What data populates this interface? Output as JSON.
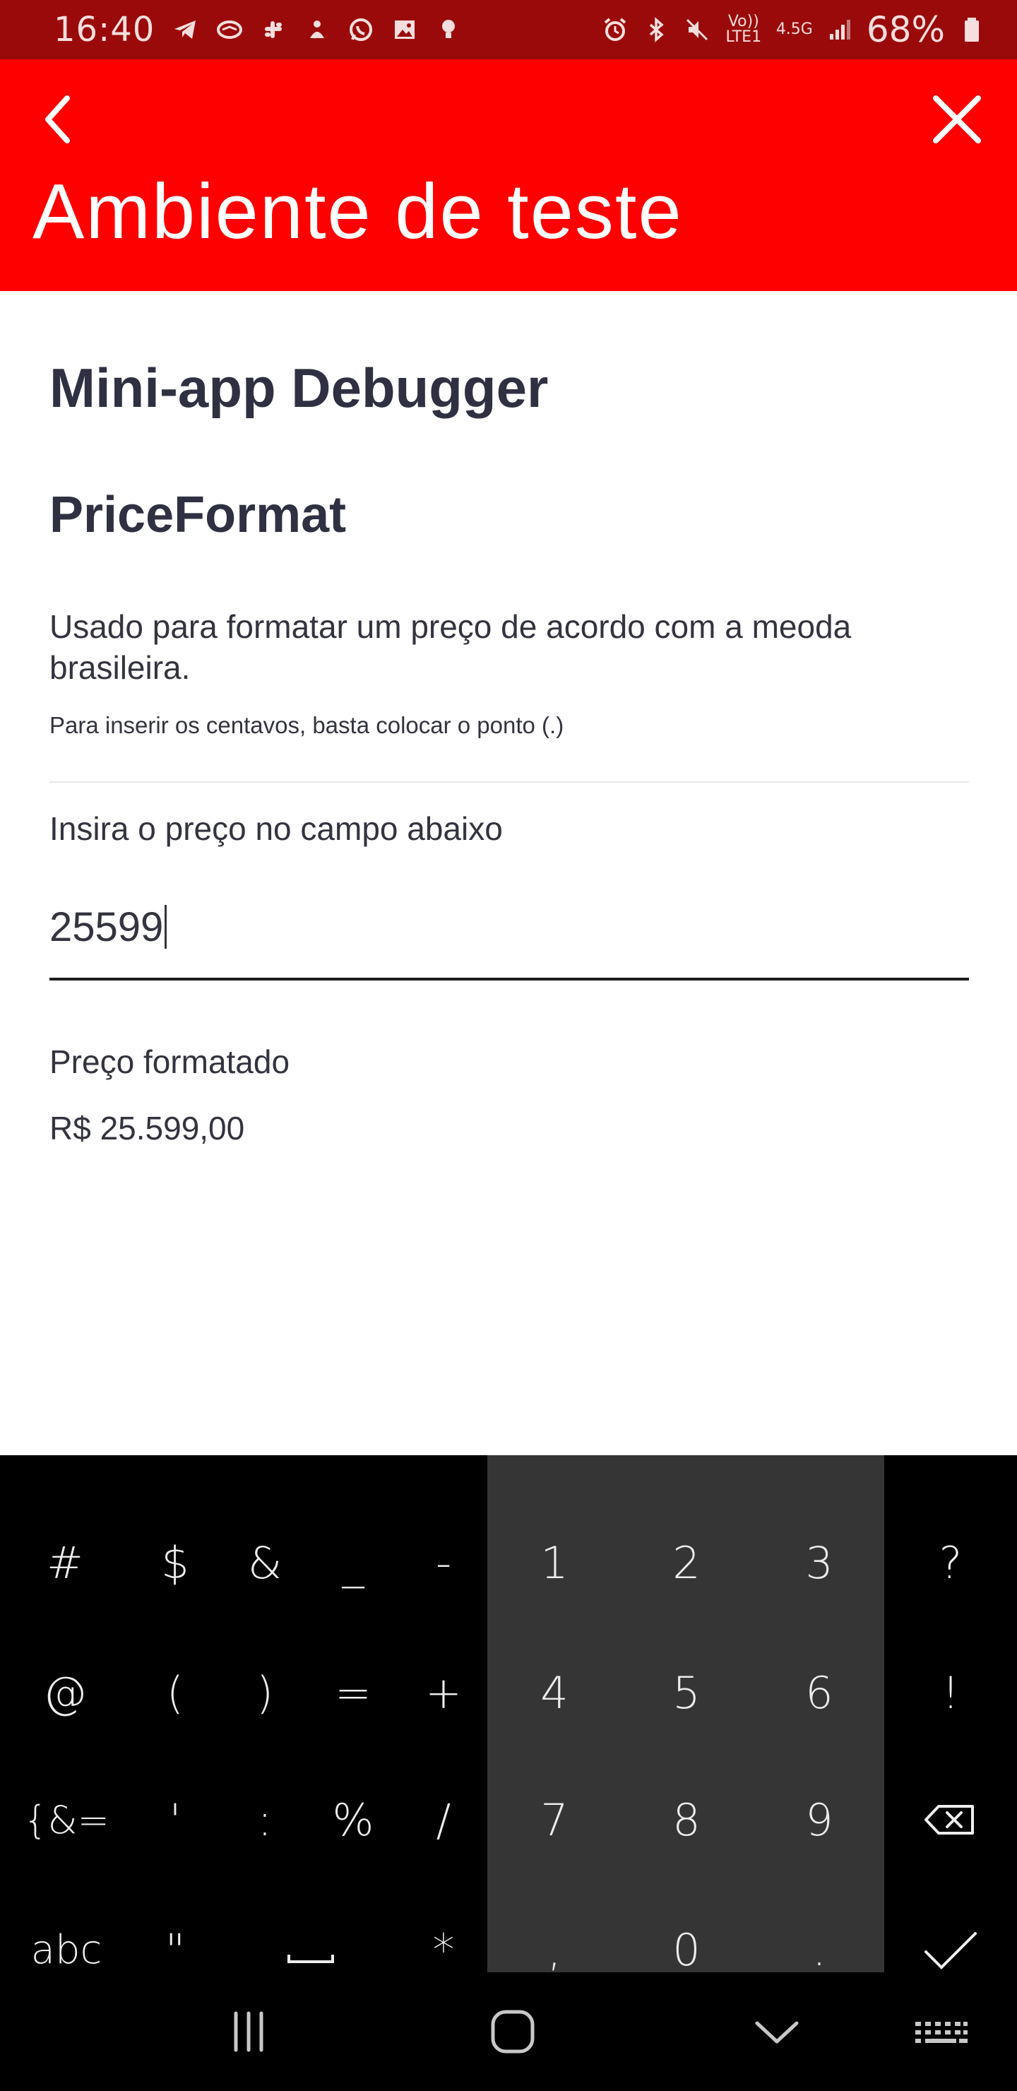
{
  "status_bar": {
    "time": "16:40",
    "battery_percent": "68%",
    "volte_label": "Vo)) LTE1",
    "network_label": "4.5G",
    "left_icons": [
      "telegram-icon",
      "handshake-icon",
      "slack-icon",
      "notification-icon",
      "whatsapp-icon",
      "gallery-icon",
      "bulb-icon"
    ],
    "right_icons": [
      "alarm-icon",
      "bluetooth-icon",
      "mute-icon",
      "signal-icon",
      "battery-icon"
    ],
    "background_color": "#9b0a0a"
  },
  "header": {
    "title": "Ambiente de teste",
    "background_color": "#fe0000",
    "back_icon": "chevron-left-icon",
    "close_icon": "close-icon"
  },
  "content": {
    "title": "Mini-app Debugger",
    "subtitle": "PriceFormat",
    "description": "Usado para formatar um preço de acordo com a meoda brasileira.",
    "hint": "Para inserir os centavos, basta colocar o ponto (.)",
    "input_label": "Insira o preço no campo abaixo",
    "input_value": "25599",
    "formatted_label": "Preço formatado",
    "formatted_value": "R$ 25.599,00"
  },
  "keyboard": {
    "symbol_rows": [
      [
        "#",
        "$",
        "&",
        "_",
        "-"
      ],
      [
        "@",
        "(",
        ")",
        "=",
        "+"
      ],
      [
        "{&=",
        "'",
        ":",
        "%",
        "/"
      ],
      [
        "abc",
        "\"",
        "space",
        "*"
      ]
    ],
    "numpad_rows": [
      [
        "1",
        "2",
        "3"
      ],
      [
        "4",
        "5",
        "6"
      ],
      [
        "7",
        "8",
        "9"
      ],
      [
        ",",
        "0",
        "."
      ]
    ],
    "right_column": [
      "?",
      "!",
      "backspace-icon",
      "check-icon"
    ]
  },
  "nav_bar": {
    "buttons": [
      "recent-apps-icon",
      "home-icon",
      "back-chevron-down-icon",
      "keyboard-icon"
    ]
  }
}
